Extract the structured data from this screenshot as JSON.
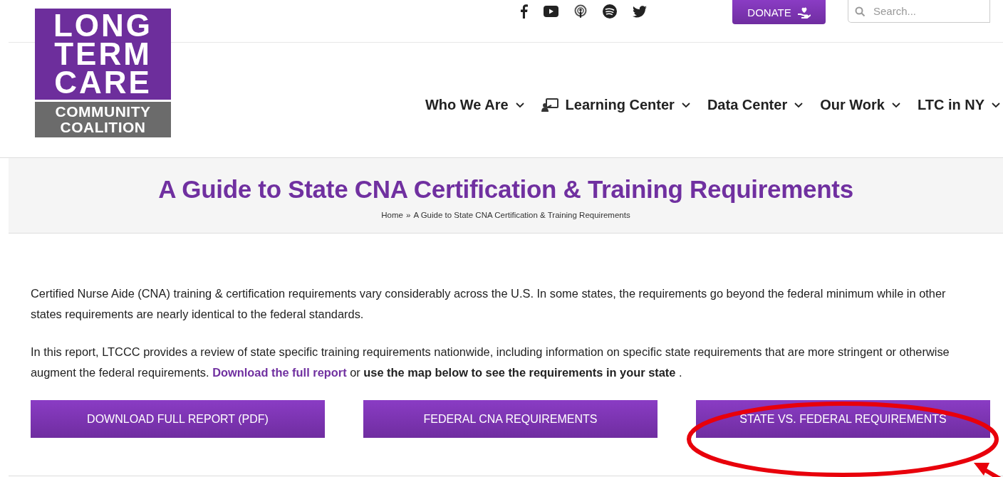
{
  "logo": {
    "lines": [
      "LONG",
      "TERM",
      "CARE"
    ],
    "sub_lines": [
      "COMMUNITY",
      "COALITION"
    ]
  },
  "social_icons": [
    {
      "kind": "facebook"
    },
    {
      "kind": "video"
    },
    {
      "kind": "podcast"
    },
    {
      "kind": "music"
    },
    {
      "kind": "bird"
    }
  ],
  "donate_button": {
    "label": "DONATE"
  },
  "search": {
    "placeholder": "Search..."
  },
  "nav": [
    {
      "label": "Who We Are",
      "kind": "plain"
    },
    {
      "label": "Learning Center",
      "kind": "icon"
    },
    {
      "label": "Data Center",
      "kind": "plain"
    },
    {
      "label": "Our Work",
      "kind": "plain"
    },
    {
      "label": "LTC in NY",
      "kind": "plain"
    }
  ],
  "page_title": "A Guide to State CNA Certification & Training Requirements",
  "breadcrumb": {
    "home": "Home",
    "separator": "»",
    "current": "A Guide to State CNA Certification & Training Requirements"
  },
  "intro": "Certified Nurse Aide (CNA) training & certification requirements vary considerably across the U.S. In some states, the requirements go beyond the federal minimum while in other states requirements are nearly identical to the federal standards.",
  "report_paragraph": {
    "before": "In this report, LTCCC provides a review of state specific training requirements nationwide, including information on specific state requirements that are more stringent or otherwise augment the federal requirements. ",
    "link": "Download the full report",
    "after": " or **use the map below to see the requirements in your state** ."
  },
  "buttons": [
    {
      "label": "DOWNLOAD FULL REPORT (PDF)",
      "highlighted": false
    },
    {
      "label": "FEDERAL CNA REQUIREMENTS",
      "highlighted": false
    },
    {
      "label": "STATE VS. FEDERAL REQUIREMENTS",
      "highlighted": true
    }
  ]
}
